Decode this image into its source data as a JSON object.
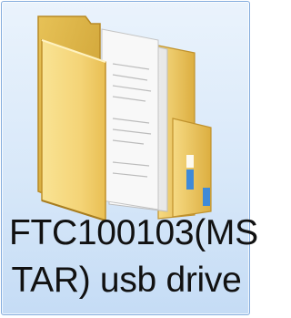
{
  "item": {
    "name_line1": "FTC100103(MS",
    "name_line2": "TAR) usb drive",
    "icon": "folder-icon",
    "state": "selected"
  },
  "colors": {
    "selection_border": "#84acdd",
    "selection_fill": "#d8e8f9",
    "folder_yellow": "#f2cf6e",
    "tab_accent": "#3f8ad8"
  }
}
